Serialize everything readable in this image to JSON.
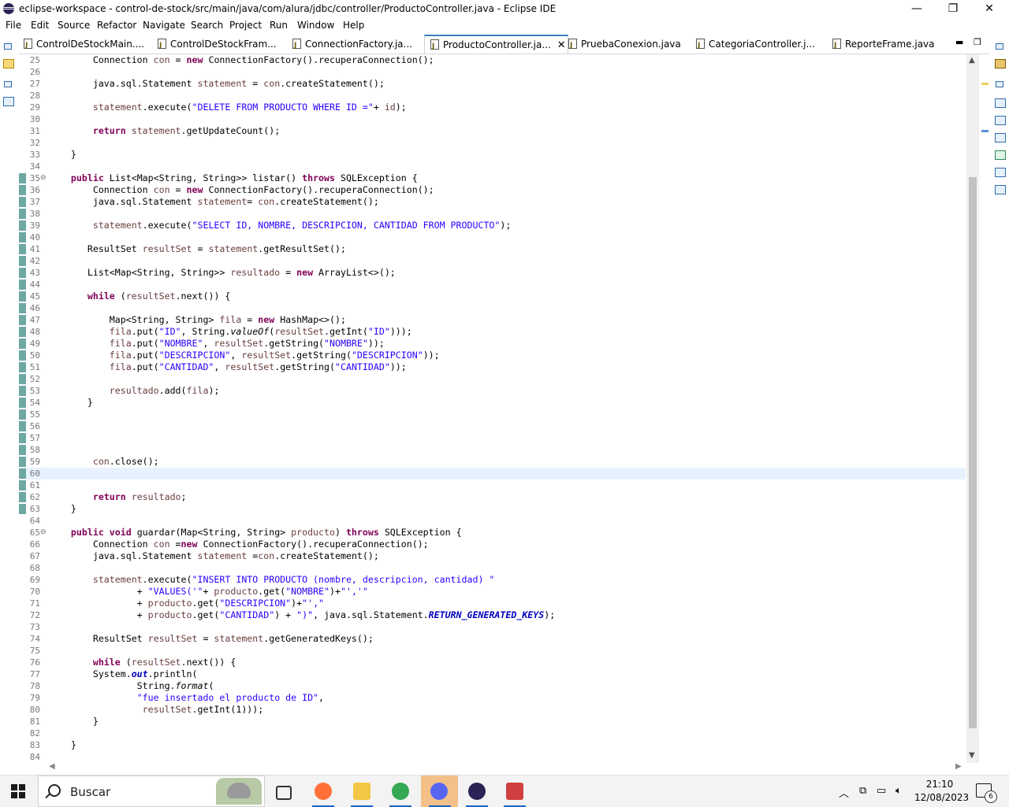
{
  "window": {
    "title": "eclipse-workspace - control-de-stock/src/main/java/com/alura/jdbc/controller/ProductoController.java - Eclipse IDE",
    "minimize": "—",
    "maximize": "❐",
    "close": "✕"
  },
  "menu": [
    "File",
    "Edit",
    "Source",
    "Refactor",
    "Navigate",
    "Search",
    "Project",
    "Run",
    "Window",
    "Help"
  ],
  "tabs": [
    {
      "label": "ControlDeStockMain...."
    },
    {
      "label": "ControlDeStockFram..."
    },
    {
      "label": "ConnectionFactory.ja..."
    },
    {
      "label": "ProductoController.ja...",
      "active": true,
      "close": "✕"
    },
    {
      "label": "PruebaConexion.java"
    },
    {
      "label": "CategoriaController.j..."
    },
    {
      "label": "ReporteFrame.java"
    }
  ],
  "editor": {
    "current_line": 60,
    "highlight_range": [
      35,
      63
    ],
    "fold_markers": [
      35,
      65
    ],
    "lines": [
      {
        "n": "25",
        "html": "        Connection <span class=\"v\">con</span> = <span class=\"k\">new</span> ConnectionFactory().recuperaConnection();"
      },
      {
        "n": "26",
        "html": ""
      },
      {
        "n": "27",
        "html": "        java.sql.Statement <span class=\"v\">statement</span> = <span class=\"v\">con</span>.createStatement();"
      },
      {
        "n": "28",
        "html": ""
      },
      {
        "n": "29",
        "html": "        <span class=\"v\">statement</span>.execute(<span class=\"s\">\"DELETE FROM PRODUCTO WHERE ID =\"</span>+ <span class=\"v\">id</span>);"
      },
      {
        "n": "30",
        "html": ""
      },
      {
        "n": "31",
        "html": "        <span class=\"k\">return</span> <span class=\"v\">statement</span>.getUpdateCount();"
      },
      {
        "n": "32",
        "html": ""
      },
      {
        "n": "33",
        "html": "    }"
      },
      {
        "n": "34",
        "html": ""
      },
      {
        "n": "35",
        "html": "    <span class=\"k\">public</span> List&lt;Map&lt;String, String&gt;&gt; listar() <span class=\"k\">throws</span> SQLException {"
      },
      {
        "n": "36",
        "html": "        Connection <span class=\"v\">con</span> = <span class=\"k\">new</span> ConnectionFactory().recuperaConnection();"
      },
      {
        "n": "37",
        "html": "        java.sql.Statement <span class=\"v\">statement</span>= <span class=\"v\">con</span>.createStatement();"
      },
      {
        "n": "38",
        "html": ""
      },
      {
        "n": "39",
        "html": "        <span class=\"v\">statement</span>.execute(<span class=\"s\">\"SELECT ID, NOMBRE, DESCRIPCION, CANTIDAD FROM PRODUCTO\"</span>);"
      },
      {
        "n": "40",
        "html": ""
      },
      {
        "n": "41",
        "html": "       ResultSet <span class=\"v\">resultSet</span> = <span class=\"v\">statement</span>.getResultSet();"
      },
      {
        "n": "42",
        "html": ""
      },
      {
        "n": "43",
        "html": "       List&lt;Map&lt;String, String&gt;&gt; <span class=\"v\">resultado</span> = <span class=\"k\">new</span> ArrayList&lt;&gt;();"
      },
      {
        "n": "44",
        "html": ""
      },
      {
        "n": "45",
        "html": "       <span class=\"k\">while</span> (<span class=\"v\">resultSet</span>.next()) {"
      },
      {
        "n": "46",
        "html": ""
      },
      {
        "n": "47",
        "html": "           Map&lt;String, String&gt; <span class=\"v\">fila</span> = <span class=\"k\">new</span> HashMap&lt;&gt;();"
      },
      {
        "n": "48",
        "html": "           <span class=\"v\">fila</span>.put(<span class=\"s\">\"ID\"</span>, String.<span class=\"i\">valueOf</span>(<span class=\"v\">resultSet</span>.getInt(<span class=\"s\">\"ID\"</span>)));"
      },
      {
        "n": "49",
        "html": "           <span class=\"v\">fila</span>.put(<span class=\"s\">\"NOMBRE\"</span>, <span class=\"v\">resultSet</span>.getString(<span class=\"s\">\"NOMBRE\"</span>));"
      },
      {
        "n": "50",
        "html": "           <span class=\"v\">fila</span>.put(<span class=\"s\">\"DESCRIPCION\"</span>, <span class=\"v\">resultSet</span>.getString(<span class=\"s\">\"DESCRIPCION\"</span>));"
      },
      {
        "n": "51",
        "html": "           <span class=\"v\">fila</span>.put(<span class=\"s\">\"CANTIDAD\"</span>, <span class=\"v\">resultSet</span>.getString(<span class=\"s\">\"CANTIDAD\"</span>));"
      },
      {
        "n": "52",
        "html": ""
      },
      {
        "n": "53",
        "html": "           <span class=\"v\">resultado</span>.add(<span class=\"v\">fila</span>);"
      },
      {
        "n": "54",
        "html": "       }"
      },
      {
        "n": "55",
        "html": ""
      },
      {
        "n": "56",
        "html": ""
      },
      {
        "n": "57",
        "html": ""
      },
      {
        "n": "58",
        "html": ""
      },
      {
        "n": "59",
        "html": "        <span class=\"v\">con</span>.close();"
      },
      {
        "n": "60",
        "html": ""
      },
      {
        "n": "61",
        "html": ""
      },
      {
        "n": "62",
        "html": "        <span class=\"k\">return</span> <span class=\"v\">resultado</span>;"
      },
      {
        "n": "63",
        "html": "    }"
      },
      {
        "n": "64",
        "html": ""
      },
      {
        "n": "65",
        "html": "    <span class=\"k\">public</span> <span class=\"k\">void</span> guardar(Map&lt;String, String&gt; <span class=\"v\">producto</span>) <span class=\"k\">throws</span> SQLException {"
      },
      {
        "n": "66",
        "html": "        Connection <span class=\"v\">con</span> =<span class=\"k\">new</span> ConnectionFactory().recuperaConnection();"
      },
      {
        "n": "67",
        "html": "        java.sql.Statement <span class=\"v\">statement</span> =<span class=\"v\">con</span>.createStatement();"
      },
      {
        "n": "68",
        "html": ""
      },
      {
        "n": "69",
        "html": "        <span class=\"v\">statement</span>.execute(<span class=\"s\">\"INSERT INTO PRODUCTO (nombre, descripcion, cantidad) \"</span>"
      },
      {
        "n": "70",
        "html": "                + <span class=\"s\">\"VALUES('\"</span>+ <span class=\"v\">producto</span>.get(<span class=\"s\">\"NOMBRE\"</span>)+<span class=\"s\">\"','\"</span>"
      },
      {
        "n": "71",
        "html": "                + <span class=\"v\">producto</span>.get(<span class=\"s\">\"DESCRIPCION\"</span>)+<span class=\"s\">\"',\"</span>"
      },
      {
        "n": "72",
        "html": "                + <span class=\"v\">producto</span>.get(<span class=\"s\">\"CANTIDAD\"</span>) + <span class=\"s\">\")\"</span>, java.sql.Statement.<span class=\"f\">RETURN_GENERATED_KEYS</span>);"
      },
      {
        "n": "73",
        "html": ""
      },
      {
        "n": "74",
        "html": "        ResultSet <span class=\"v\">resultSet</span> = <span class=\"v\">statement</span>.getGeneratedKeys();"
      },
      {
        "n": "75",
        "html": ""
      },
      {
        "n": "76",
        "html": "        <span class=\"k\">while</span> (<span class=\"v\">resultSet</span>.next()) {"
      },
      {
        "n": "77",
        "html": "        System.<span class=\"o\">out</span>.println("
      },
      {
        "n": "78",
        "html": "                String.<span class=\"i\">format</span>("
      },
      {
        "n": "79",
        "html": "                <span class=\"s\">\"fue insertado el producto de ID\"</span>,"
      },
      {
        "n": "80",
        "html": "                 <span class=\"v\">resultSet</span>.getInt(1)));"
      },
      {
        "n": "81",
        "html": "        }"
      },
      {
        "n": "82",
        "html": ""
      },
      {
        "n": "83",
        "html": "    }"
      },
      {
        "n": "84",
        "html": ""
      }
    ]
  },
  "taskbar": {
    "search_placeholder": "Buscar",
    "time": "21:10",
    "date": "12/08/2023",
    "notification_count": "6",
    "apps": [
      {
        "name": "task-view-icon",
        "color": "#333333"
      },
      {
        "name": "firefox-icon",
        "color": "#ff7139"
      },
      {
        "name": "file-explorer-icon",
        "color": "#f2c744"
      },
      {
        "name": "chrome-icon",
        "color": "#34a853"
      },
      {
        "name": "discord-icon",
        "color": "#5865f2"
      },
      {
        "name": "eclipse-icon",
        "color": "#2c2255"
      },
      {
        "name": "java-app-icon",
        "color": "#d04040"
      }
    ]
  },
  "colors": {
    "keyword": "#7f0055",
    "string": "#2a00ff",
    "variable": "#6a3e3e",
    "field": "#0000c0",
    "current_line": "#e8f2fe",
    "change_bar": "#6da8a3",
    "active_tab_accent": "#3b7fc4"
  }
}
